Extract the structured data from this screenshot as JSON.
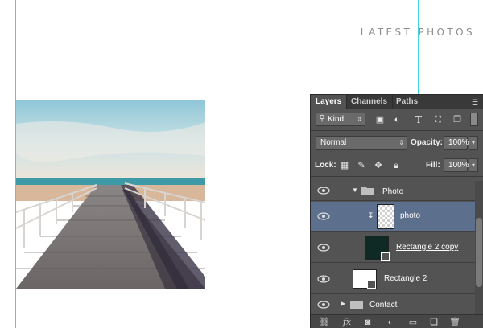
{
  "canvas": {
    "heading": "LATEST PHOTOS"
  },
  "layers_panel": {
    "tabs": [
      {
        "label": "Layers",
        "active": true
      },
      {
        "label": "Channels",
        "active": false
      },
      {
        "label": "Paths",
        "active": false
      }
    ],
    "filter": {
      "value": "Kind"
    },
    "blend_mode": {
      "value": "Normal"
    },
    "opacity": {
      "label": "Opacity:",
      "value": "100%"
    },
    "lock": {
      "label": "Lock:"
    },
    "fill": {
      "label": "Fill:",
      "value": "100%"
    },
    "layers": [
      {
        "name": "Photo",
        "type": "group",
        "expanded": true,
        "selected": false
      },
      {
        "name": "photo",
        "type": "clipped-layer",
        "selected": true
      },
      {
        "name": "Rectangle 2 copy",
        "type": "shape",
        "selected": false,
        "thumb_color": "#0f2a25"
      },
      {
        "name": "Rectangle 2",
        "type": "shape",
        "selected": false,
        "thumb_color": "#ffffff"
      },
      {
        "name": "Contact",
        "type": "group",
        "expanded": false,
        "selected": false
      }
    ],
    "bottom_icons": [
      "link-icon",
      "fx-icon",
      "mask-icon",
      "adjustment-icon",
      "folder-icon",
      "new-layer-icon",
      "trash-icon"
    ]
  },
  "colors": {
    "guide": "#3fd3e0",
    "selection": "#5c6f8c",
    "panel_bg": "#535353"
  }
}
